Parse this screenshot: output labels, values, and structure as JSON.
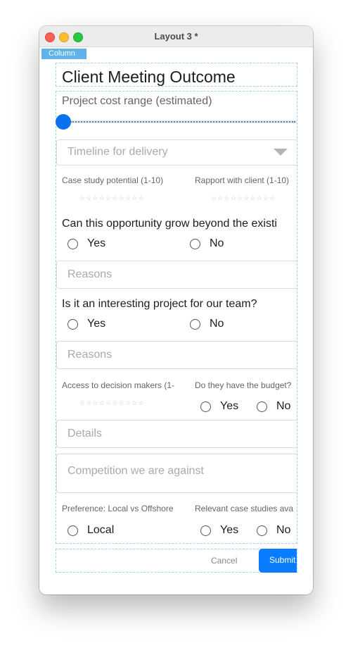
{
  "window": {
    "title": "Layout 3 *",
    "column_tag": "Column"
  },
  "form": {
    "title": "Client Meeting Outcome",
    "cost_range_label": "Project cost range (estimated)",
    "cost_range_value": 0,
    "timeline": {
      "placeholder": "Timeline for delivery"
    },
    "case_study_potential_label": "Case study potential (1-10)",
    "rapport_label": "Rapport with client (1-10)",
    "stars": "☆☆☆☆☆☆☆☆☆☆",
    "grow_question": "Can this opportunity grow beyond the existi",
    "interesting_question": "Is it an interesting project for our team?",
    "yes": "Yes",
    "no": "No",
    "reasons_placeholder": "Reasons",
    "access_label": "Access to decision makers (1-",
    "budget_label": "Do they have the budget?",
    "details_placeholder": "Details",
    "competition_placeholder": "Competition we are against",
    "preference_label": "Preference: Local vs Offshore",
    "local": "Local",
    "relevant_label": "Relevant case studies ava",
    "cancel": "Cancel",
    "submit": "Submit"
  },
  "colors": {
    "accent": "#0a7cff",
    "guide": "#9fd2f3",
    "column_tag": "#5fb3e6"
  }
}
